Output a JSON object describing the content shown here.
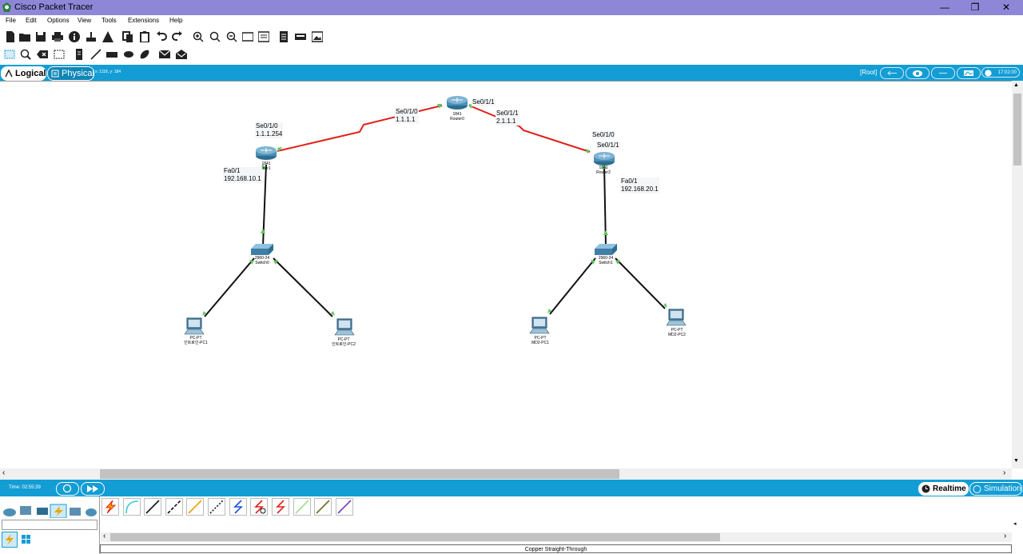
{
  "window": {
    "title": "Cisco Packet Tracer",
    "minimize": "—",
    "restore": "❐",
    "close": "✕"
  },
  "menu": [
    "File",
    "Edit",
    "Options",
    "View",
    "Tools",
    "Extensions",
    "Help"
  ],
  "help_label": "?",
  "modes": {
    "logical": "Logical",
    "physical": "Physical",
    "coords": "x: 1118, y: 184"
  },
  "root_label": "[Root]",
  "clock": "17:02:00",
  "labels": {
    "r0_se011_top": "Se0/1/1",
    "r0_left": "Se0/1/0\n1.1.1.1",
    "r0_right": "Se0/1/1\n2.1.1.1",
    "r1_serial": "Se0/1/0\n1.1.1.254",
    "r1_fa": "Fa0/1\n192.168.10.1",
    "r2_serial_top": "Se0/1/0",
    "r2_serial_bottom": "Se0/1/1",
    "r2_fa": "Fa0/1\n192.168.20.1"
  },
  "devices": {
    "router0": {
      "model": "1841",
      "name": "Router0"
    },
    "router1": {
      "model": "1841",
      "name": "uter1"
    },
    "router2": {
      "model": "1841",
      "name": "Router2"
    },
    "switch0": {
      "model": "2960-24",
      "name": "Switch0"
    },
    "switch1": {
      "model": "2960-24",
      "name": "Switch1"
    },
    "pc1": {
      "model": "PC-PT",
      "name": "인트로인-PC1"
    },
    "pc2": {
      "model": "PC-PT",
      "name": "인트로인-PC2"
    },
    "pc3": {
      "model": "PC-PT",
      "name": "MD2-PC1"
    },
    "pc4": {
      "model": "PC-PT",
      "name": "MD2-PC2"
    }
  },
  "sim": {
    "time": "Time: 02:55:39",
    "realtime": "Realtime",
    "simulation": "Simulation"
  },
  "status_text": "Copper Straight-Through",
  "colors": {
    "title_bar": "#8e87d8",
    "accent": "#139dd4",
    "serial_link": "#e0201a",
    "copper_link": "#111111",
    "port_up": "#5cc85c"
  }
}
